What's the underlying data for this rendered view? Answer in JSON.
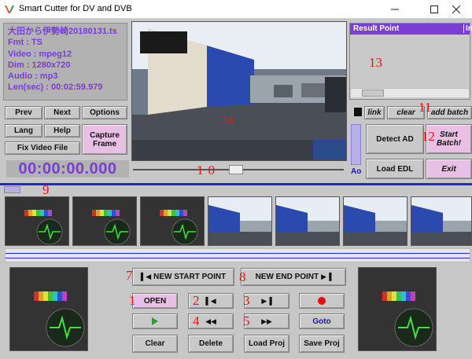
{
  "window": {
    "title": "Smart Cutter for DV and DVB"
  },
  "file_info": {
    "filename": "大田から伊勢崎20180131.ts",
    "format": "Fmt : TS",
    "video": "Video : mpeg12",
    "dim": "Dim : 1280x720",
    "audio": "Audio : mp3",
    "length": "Len(sec) : 00:02:59.979"
  },
  "left_buttons": {
    "prev": "Prev",
    "next": "Next",
    "options": "Options",
    "lang": "Lang",
    "help": "Help",
    "capture": "Capture Frame",
    "fix": "Fix Video File"
  },
  "timecode": "00:00:00.000",
  "results": {
    "col1": "Result Point",
    "col2": "In"
  },
  "right_buttons": {
    "link": "link",
    "clear": "clear",
    "add_batch": "add batch",
    "detect_ad": "Detect AD",
    "start_batch": "Start Batch!",
    "load_edl": "Load EDL",
    "exit": "Exit",
    "ao": "Ao"
  },
  "bottom_buttons": {
    "new_start": "NEW START POINT",
    "new_end": "NEW END POINT",
    "open": "OPEN",
    "goto": "Goto",
    "clear": "Clear",
    "delete": "Delete",
    "load_proj": "Load Proj",
    "save_proj": "Save Proj"
  },
  "annotations": [
    "1",
    "2",
    "3",
    "4",
    "5",
    "7",
    "8",
    "9",
    "10",
    "11",
    "12",
    "13",
    "14"
  ],
  "colors": {
    "accent_purple": "#7a3dd6",
    "timeline_blue": "#2424d6",
    "pink_button": "#e9bfe6",
    "marker_red": "#e11111"
  }
}
